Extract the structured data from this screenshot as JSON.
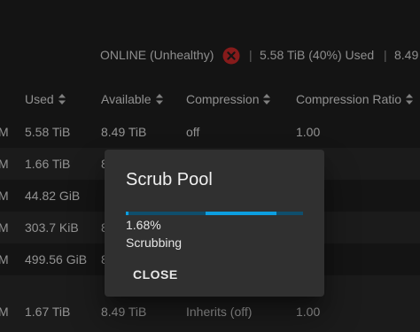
{
  "pool_status": {
    "state": "ONLINE (Unhealthy)",
    "state_icon": "error-circle-icon",
    "usage": "5.58 TiB (40%) Used",
    "available_partial": "8.49",
    "separator": "|"
  },
  "table": {
    "columns": [
      {
        "label": "Used",
        "sort_icon": "sort-icon"
      },
      {
        "label": "Available",
        "sort_icon": "sort-icon"
      },
      {
        "label": "Compression",
        "sort_icon": "sort-icon"
      },
      {
        "label": "Compression Ratio",
        "sort_icon": "sort-icon"
      }
    ],
    "rows": [
      {
        "prefix": "M",
        "used": "5.58 TiB",
        "available": "8.49 TiB",
        "compression": "off",
        "ratio": "1.00"
      },
      {
        "prefix": "M",
        "used": "1.66 TiB",
        "available": "8",
        "compression": "",
        "ratio": ""
      },
      {
        "prefix": "M",
        "used": "44.82 GiB",
        "available": "",
        "compression": "",
        "ratio": ""
      },
      {
        "prefix": "M",
        "used": "303.7 KiB",
        "available": "8",
        "compression": "",
        "ratio": ""
      },
      {
        "prefix": "M",
        "used": "499.56 GiB",
        "available": "8",
        "compression": "",
        "ratio": ""
      },
      {
        "prefix": "",
        "used": "",
        "available": "",
        "compression": "",
        "ratio": ""
      },
      {
        "prefix": "M",
        "used": "1.67 TiB",
        "available": "8.49 TiB",
        "compression": "Inherits (off)",
        "ratio": "1.00"
      }
    ]
  },
  "dialog": {
    "title": "Scrub Pool",
    "progress_percent": 1.68,
    "progress_text": "1.68%",
    "status": "Scrubbing",
    "close_label": "CLOSE"
  },
  "colors": {
    "background": "#1e1e1e",
    "row_alt": "#282828",
    "dialog_bg": "#303030",
    "progress_accent": "#0c9ee0",
    "progress_track": "#0f4e6c",
    "error_red": "#c62828"
  }
}
